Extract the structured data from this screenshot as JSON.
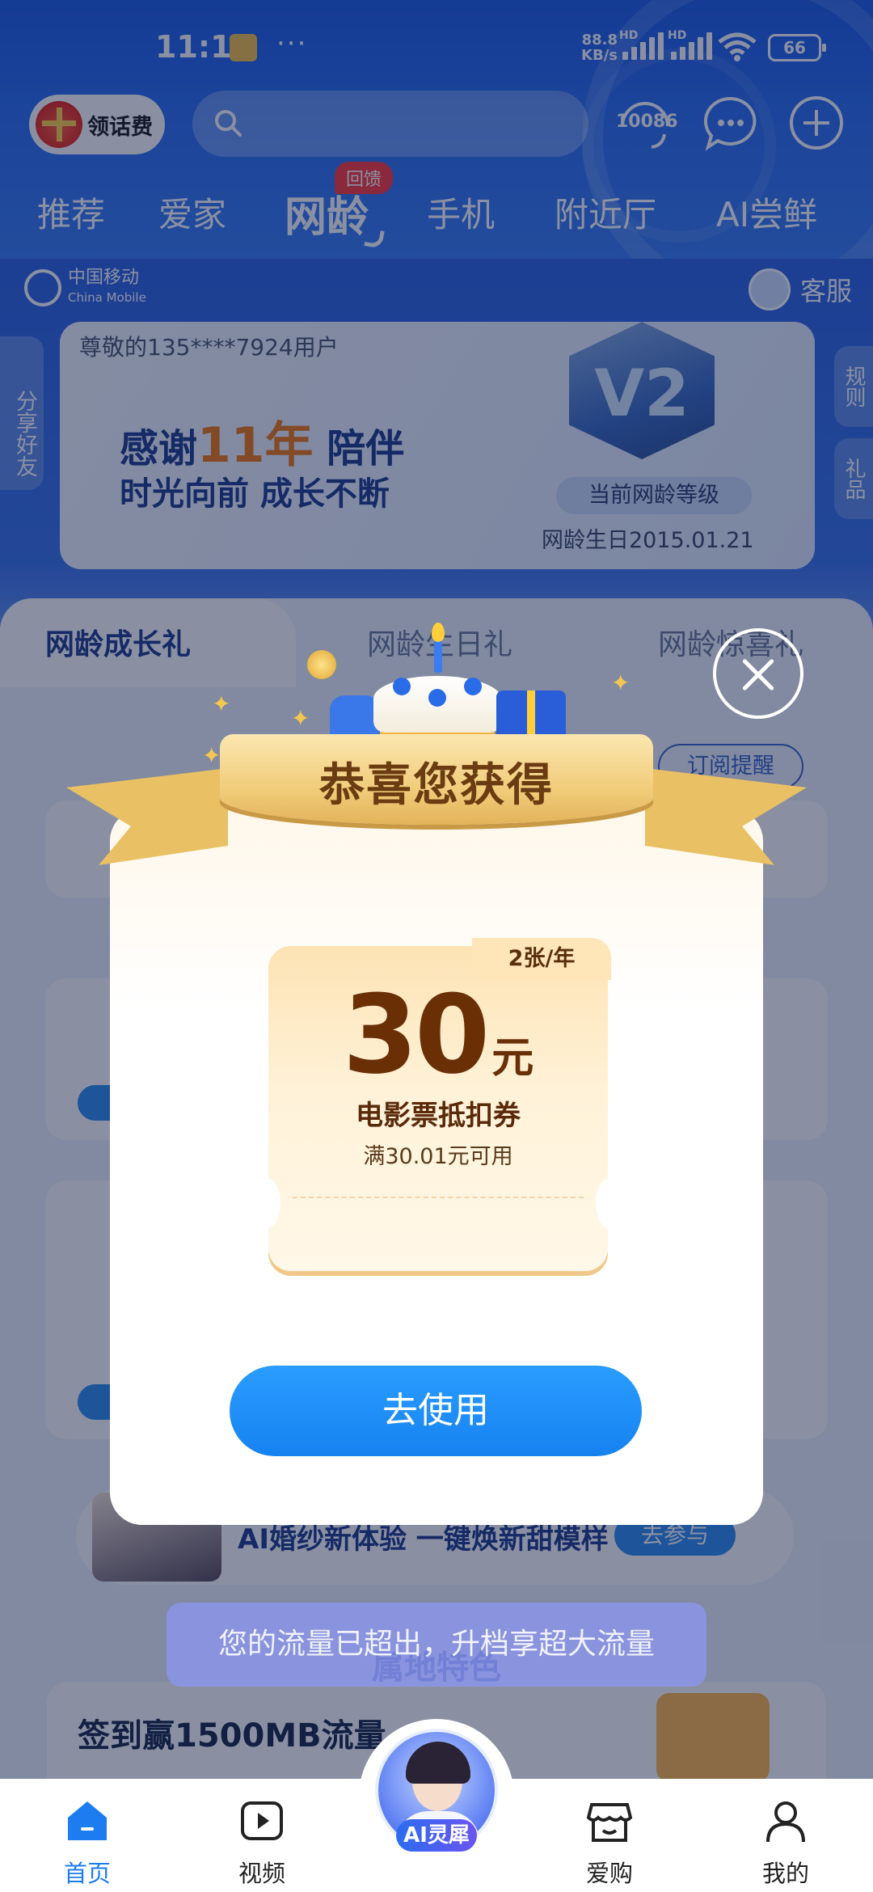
{
  "status_bar": {
    "time": "11:15",
    "more": "···",
    "net_speed": "88.8",
    "net_unit": "KB/s",
    "battery": "66",
    "hd_label": "HD"
  },
  "header": {
    "gift_button_label": "领话费",
    "hotline": "10086",
    "tabs": [
      {
        "label": "推荐"
      },
      {
        "label": "爱家"
      },
      {
        "label": "网龄",
        "badge": "回馈"
      },
      {
        "label": "手机"
      },
      {
        "label": "附近厅"
      },
      {
        "label": "AI尝鲜"
      }
    ]
  },
  "page": {
    "brand_cn": "中国移动",
    "brand_en": "China Mobile",
    "service_label": "客服",
    "share_label": "分享好友",
    "rules_label": "规则",
    "gift_label": "礼品",
    "member": {
      "greeting": "尊敬的135****7924用户",
      "line1_prefix": "感谢",
      "years": "11年",
      "line1_suffix": "陪伴",
      "line2": "时光向前 成长不断",
      "level": "V2",
      "level_caption": "当前网龄等级",
      "birthday": "网龄生日2015.01.21"
    },
    "growth_tabs": [
      "网龄成长礼",
      "网龄生日礼",
      "网龄惊喜礼"
    ],
    "subscribe_label": "订阅提醒",
    "wedding_text": "AI婚纱新体验 一键焕新甜模样",
    "wedding_button": "去参与",
    "section_title": "属地特色",
    "checkin_title": "签到赢1500MB流量"
  },
  "modal": {
    "title": "恭喜您获得",
    "tag": "2张/年",
    "amount": "30",
    "unit": "元",
    "name": "电影票抵扣券",
    "condition": "满30.01元可用",
    "button": "去使用"
  },
  "toast": "您的流量已超出，升档享超大流量",
  "bottom_nav": [
    {
      "label": "首页",
      "icon": "home-icon",
      "active": true
    },
    {
      "label": "视频",
      "icon": "video-icon"
    },
    {
      "label": "AI灵犀",
      "icon": "ai-assistant-avatar"
    },
    {
      "label": "爱购",
      "icon": "shop-icon"
    },
    {
      "label": "我的",
      "icon": "profile-icon"
    }
  ],
  "colors": {
    "header_blue": "#2f72f2",
    "accent_orange": "#f07a14",
    "button_blue": "#1d7cf0",
    "ribbon_gold": "#f1cd7b",
    "coupon_brown": "#6b2f06"
  }
}
